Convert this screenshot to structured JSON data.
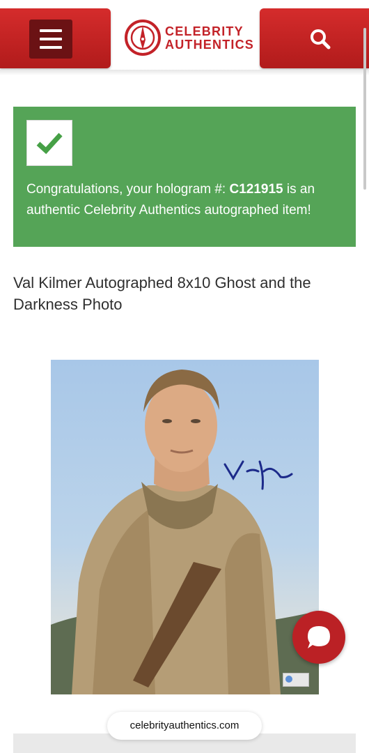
{
  "header": {
    "logo_line1": "CELEBRITY",
    "logo_line2": "AUTHENTICS",
    "menu_icon": "hamburger-icon",
    "search_icon": "search-icon"
  },
  "verification": {
    "prefix": "Congratulations, your hologram #: ",
    "hologram_number": "C121915",
    "suffix": " is an authentic Celebrity Authentics autographed item!",
    "status_icon": "checkmark-icon"
  },
  "item": {
    "title": "Val Kilmer Autographed 8x10 Ghost and the Darkness Photo",
    "image_description": "autographed-photo"
  },
  "chat": {
    "icon": "chat-bubble-icon"
  },
  "browser": {
    "url": "celebrityauthentics.com"
  },
  "colors": {
    "brand_red": "#c32228",
    "success_green": "#55a457",
    "menu_dark": "#6b1214"
  }
}
